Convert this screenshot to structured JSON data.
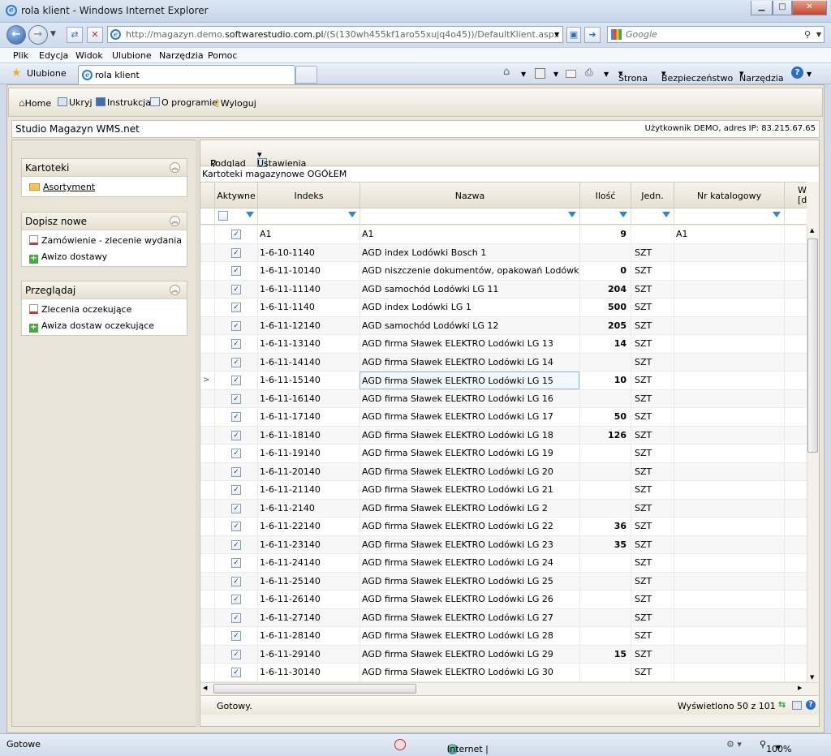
{
  "window": {
    "title": "rola klient - Windows Internet Explorer",
    "address": {
      "prefix": "http://magazyn.demo.",
      "domain": "softwarestudio.com.pl",
      "suffix": "/(S(130wh455kf1aro55xujq4o45))/DefaultKlient.aspx"
    },
    "search_placeholder": "Google"
  },
  "menu": [
    "Plik",
    "Edycja",
    "Widok",
    "Ulubione",
    "Narzędzia",
    "Pomoc"
  ],
  "favorites_label": "Ulubione",
  "tab_title": "rola klient",
  "ie_commands": [
    "Strona",
    "Bezpieczeństwo",
    "Narzędzia"
  ],
  "app_toolbar": [
    "Home",
    "Ukryj",
    "Instrukcja",
    "O programie",
    "Wyloguj"
  ],
  "app": {
    "title": "Studio Magazyn WMS.net",
    "user_info": "Użytkownik DEMO, adres IP: 83.215.67.65"
  },
  "sidebar": {
    "panels": [
      {
        "title": "Kartoteki",
        "items": [
          "Asortyment"
        ]
      },
      {
        "title": "Dopisz nowe",
        "items": [
          "Zamówienie - zlecenie wydania",
          "Awizo dostawy"
        ]
      },
      {
        "title": "Przeglądaj",
        "items": [
          "Zlecenia oczekujące",
          "Awiza dostaw oczekujące"
        ]
      }
    ]
  },
  "grid": {
    "toolbar": {
      "preview": "Podgląd",
      "settings": "Ustawienia"
    },
    "caption": "Kartoteki magazynowe OGÓŁEM",
    "columns": [
      "Aktywne",
      "Indeks",
      "Nazwa",
      "Ilość",
      "Jedn.",
      "Nr katalogowy",
      "Waga [d"
    ],
    "rows": [
      {
        "idx": "A1",
        "name": "A1",
        "qty": "9",
        "unit": "",
        "cat": "A1"
      },
      {
        "idx": "1-6-10-1140",
        "name": "AGD index Lodówki Bosch 1",
        "qty": "",
        "unit": "SZT",
        "cat": ""
      },
      {
        "idx": "1-6-11-10140",
        "name": "AGD niszczenie dokumentów, opakowań Lodówki ...",
        "qty": "0",
        "unit": "SZT",
        "cat": ""
      },
      {
        "idx": "1-6-11-11140",
        "name": "AGD samochód Lodówki LG 11",
        "qty": "204",
        "unit": "SZT",
        "cat": ""
      },
      {
        "idx": "1-6-11-1140",
        "name": "AGD index Lodówki LG 1",
        "qty": "500",
        "unit": "SZT",
        "cat": ""
      },
      {
        "idx": "1-6-11-12140",
        "name": "AGD samochód Lodówki LG 12",
        "qty": "205",
        "unit": "SZT",
        "cat": ""
      },
      {
        "idx": "1-6-11-13140",
        "name": "AGD firma Sławek ELEKTRO Lodówki LG 13",
        "qty": "14",
        "unit": "SZT",
        "cat": ""
      },
      {
        "idx": "1-6-11-14140",
        "name": "AGD firma Sławek ELEKTRO Lodówki LG 14",
        "qty": "",
        "unit": "SZT",
        "cat": ""
      },
      {
        "idx": "1-6-11-15140",
        "name": "AGD firma Sławek ELEKTRO Lodówki LG 15",
        "qty": "10",
        "unit": "SZT",
        "cat": ""
      },
      {
        "idx": "1-6-11-16140",
        "name": "AGD firma Sławek ELEKTRO Lodówki LG 16",
        "qty": "",
        "unit": "SZT",
        "cat": ""
      },
      {
        "idx": "1-6-11-17140",
        "name": "AGD firma Sławek ELEKTRO Lodówki LG 17",
        "qty": "50",
        "unit": "SZT",
        "cat": ""
      },
      {
        "idx": "1-6-11-18140",
        "name": "AGD firma Sławek ELEKTRO Lodówki LG 18",
        "qty": "126",
        "unit": "SZT",
        "cat": ""
      },
      {
        "idx": "1-6-11-19140",
        "name": "AGD firma Sławek ELEKTRO Lodówki LG 19",
        "qty": "",
        "unit": "SZT",
        "cat": ""
      },
      {
        "idx": "1-6-11-20140",
        "name": "AGD firma Sławek ELEKTRO Lodówki LG 20",
        "qty": "",
        "unit": "SZT",
        "cat": ""
      },
      {
        "idx": "1-6-11-21140",
        "name": "AGD firma Sławek ELEKTRO Lodówki LG 21",
        "qty": "",
        "unit": "SZT",
        "cat": ""
      },
      {
        "idx": "1-6-11-2140",
        "name": "AGD firma Sławek ELEKTRO Lodówki LG 2",
        "qty": "",
        "unit": "SZT",
        "cat": ""
      },
      {
        "idx": "1-6-11-22140",
        "name": "AGD firma Sławek ELEKTRO Lodówki LG 22",
        "qty": "36",
        "unit": "SZT",
        "cat": ""
      },
      {
        "idx": "1-6-11-23140",
        "name": "AGD firma Sławek ELEKTRO Lodówki LG 23",
        "qty": "35",
        "unit": "SZT",
        "cat": ""
      },
      {
        "idx": "1-6-11-24140",
        "name": "AGD firma Sławek ELEKTRO Lodówki LG 24",
        "qty": "",
        "unit": "SZT",
        "cat": ""
      },
      {
        "idx": "1-6-11-25140",
        "name": "AGD firma Sławek ELEKTRO Lodówki LG 25",
        "qty": "",
        "unit": "SZT",
        "cat": ""
      },
      {
        "idx": "1-6-11-26140",
        "name": "AGD firma Sławek ELEKTRO Lodówki LG 26",
        "qty": "",
        "unit": "SZT",
        "cat": ""
      },
      {
        "idx": "1-6-11-27140",
        "name": "AGD firma Sławek ELEKTRO Lodówki LG 27",
        "qty": "",
        "unit": "SZT",
        "cat": ""
      },
      {
        "idx": "1-6-11-28140",
        "name": "AGD firma Sławek ELEKTRO Lodówki LG 28",
        "qty": "",
        "unit": "SZT",
        "cat": ""
      },
      {
        "idx": "1-6-11-29140",
        "name": "AGD firma Sławek ELEKTRO Lodówki LG 29",
        "qty": "15",
        "unit": "SZT",
        "cat": ""
      },
      {
        "idx": "1-6-11-30140",
        "name": "AGD firma Sławek ELEKTRO Lodówki LG 30",
        "qty": "",
        "unit": "SZT",
        "cat": ""
      }
    ],
    "selected_row_index": 8,
    "status": "Gotowy.",
    "count_text": "Wyświetlono 50 z 101"
  },
  "ie_status": {
    "left": "Gotowe",
    "zone": "Internet | Tryb chroniony: włączony",
    "zoom": "100%"
  },
  "colors": {
    "accent": "#2b86d8",
    "panel_bg": "#e8e4d8",
    "ie_chrome": "#cfdbe8"
  }
}
